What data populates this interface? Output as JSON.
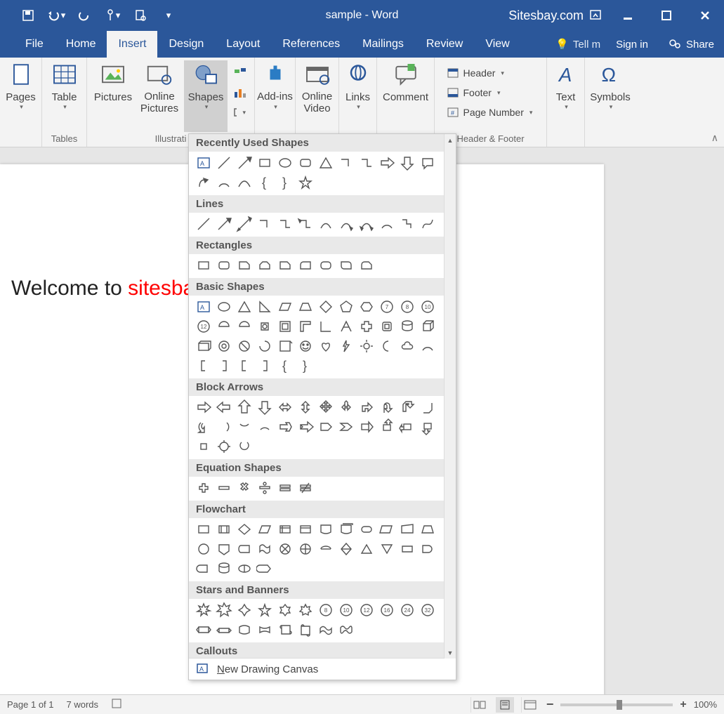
{
  "title": "sample - Word",
  "brand": "Sitesbay.com",
  "menu": {
    "file": "File",
    "home": "Home",
    "insert": "Insert",
    "design": "Design",
    "layout": "Layout",
    "references": "References",
    "mailings": "Mailings",
    "review": "Review",
    "view": "View",
    "tell": "Tell m",
    "signin": "Sign in",
    "share": "Share"
  },
  "ribbon": {
    "pages": "Pages",
    "table": "Table",
    "pictures": "Pictures",
    "online_pictures": "Online Pictures",
    "shapes": "Shapes",
    "addins": "Add-ins",
    "online_video": "Online Video",
    "links": "Links",
    "comment": "Comment",
    "header": "Header",
    "footer": "Footer",
    "page_number": "Page Number",
    "text": "Text",
    "symbols": "Symbols",
    "grp_tables": "Tables",
    "grp_illus": "Illustrati",
    "grp_hf": "Header & Footer"
  },
  "document": {
    "welcome": "Welcome to ",
    "brand_partial": "sitesba"
  },
  "shapes": {
    "recently": "Recently Used Shapes",
    "lines": "Lines",
    "rectangles": "Rectangles",
    "basic": "Basic Shapes",
    "block": "Block Arrows",
    "equation": "Equation Shapes",
    "flowchart": "Flowchart",
    "stars": "Stars and Banners",
    "callouts": "Callouts",
    "new_canvas": "ew Drawing Canvas",
    "new_canvas_u": "N"
  },
  "status": {
    "page": "Page 1 of 1",
    "words": "7 words",
    "zoom": "100%"
  }
}
